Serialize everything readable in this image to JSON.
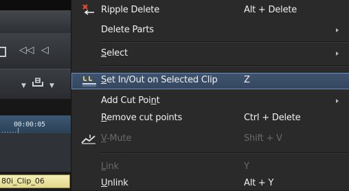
{
  "editor": {
    "timecode": "00:00:05",
    "ruler_dots": "......|",
    "clip_label": "80i_Clip_06"
  },
  "menu": {
    "items": [
      {
        "label": "Ripple Delete",
        "shortcut": "Alt + Delete",
        "icon": "ripple-delete-icon",
        "enabled": true
      },
      {
        "label": "Delete Parts",
        "shortcut": "",
        "submenu": true,
        "enabled": true
      },
      {
        "label": "Select",
        "mnemonic": "S",
        "shortcut": "",
        "submenu": true,
        "enabled": true
      },
      {
        "label": "Set In/Out on Selected Clip",
        "mnemonic": "S",
        "shortcut": "Z",
        "icon": "set-in-out-icon",
        "highlighted": true,
        "enabled": true
      },
      {
        "label": "Add Cut Point",
        "mnemonic": "n",
        "shortcut": "",
        "submenu": true,
        "enabled": true
      },
      {
        "label": "Remove cut points",
        "mnemonic": "R",
        "shortcut": "Ctrl + Delete",
        "enabled": true
      },
      {
        "label": "V-Mute",
        "mnemonic": "V",
        "shortcut": "Shift + V",
        "icon": "video-mute-icon",
        "enabled": false
      },
      {
        "label": "Link",
        "mnemonic": "L",
        "shortcut": "Y",
        "enabled": false
      },
      {
        "label": "Unlink",
        "mnemonic": "U",
        "shortcut": "Alt + Y",
        "enabled": true
      }
    ]
  },
  "colors": {
    "menu_bg": "#2a2a2a",
    "highlight_bg": "#3f5470",
    "highlight_border": "#6d8fb9",
    "text": "#f0f0f0",
    "disabled_text": "#6a6a6a",
    "clip_fill": "#eee6a4"
  }
}
